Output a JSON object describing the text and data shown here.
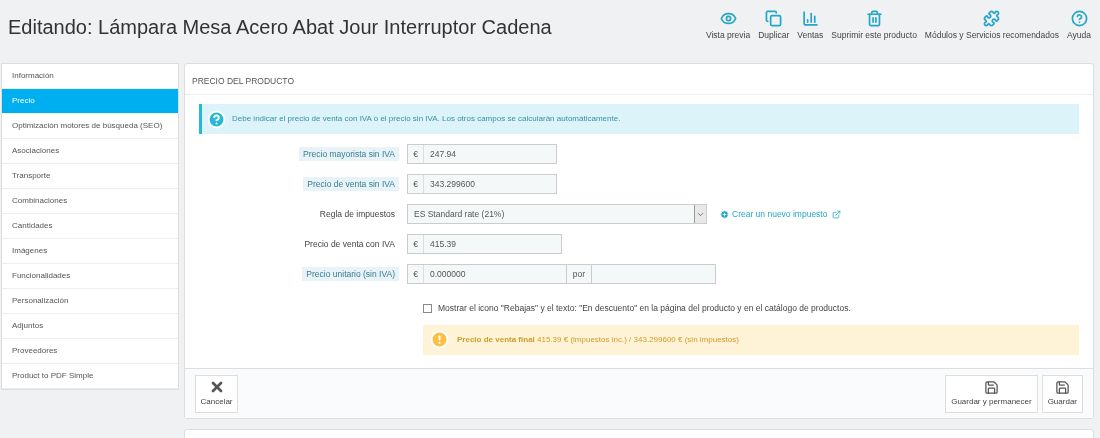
{
  "title": "Editando: Lámpara Mesa Acero Abat Jour Interruptor Cadena",
  "toolbar": [
    {
      "kind": "eye",
      "label": "Vista previa"
    },
    {
      "kind": "copy",
      "label": "Duplicar"
    },
    {
      "kind": "chart",
      "label": "Ventas"
    },
    {
      "kind": "trash",
      "label": "Suprimir este producto"
    },
    {
      "kind": "puzzle",
      "label": "Módulos y Servicios recomendados"
    },
    {
      "kind": "help",
      "label": "Ayuda"
    }
  ],
  "sidebar": {
    "items": [
      {
        "label": "Información",
        "selected": false
      },
      {
        "label": "Precio",
        "selected": true
      },
      {
        "label": "Optimización motores de búsqueda (SEO)",
        "selected": false
      },
      {
        "label": "Asociaciones",
        "selected": false
      },
      {
        "label": "Transporte",
        "selected": false
      },
      {
        "label": "Combinaciones",
        "selected": false
      },
      {
        "label": "Cantidades",
        "selected": false
      },
      {
        "label": "Imágenes",
        "selected": false
      },
      {
        "label": "Funcionalidades",
        "selected": false
      },
      {
        "label": "Personalización",
        "selected": false
      },
      {
        "label": "Adjuntos",
        "selected": false
      },
      {
        "label": "Proveedores",
        "selected": false
      },
      {
        "label": "Product to PDF Simple",
        "selected": false
      }
    ]
  },
  "panel": {
    "heading": "PRECIO DEL PRODUCTO",
    "info": "Debe indicar el precio de venta con IVA o el precio sin IVA. Los otros campos se calcularán automáticamente.",
    "fields": [
      {
        "kind": "money",
        "label": "Precio mayorista sin IVA",
        "has_help": true,
        "currency": "€",
        "value": "247.94"
      },
      {
        "kind": "money",
        "label": "Precio de venta sin IVA",
        "has_help": true,
        "currency": "€",
        "value": "343.299600"
      },
      {
        "kind": "select",
        "label": "Regla de impuestos",
        "has_help": false,
        "value": "ES Standard rate (21%)",
        "link": "Crear un nuevo impuesto"
      },
      {
        "kind": "money",
        "label": "Precio de venta con IVA",
        "has_help": false,
        "currency": "€",
        "value": "415.39"
      },
      {
        "kind": "unit",
        "label": "Precio unitario (sin IVA)",
        "has_help": true,
        "currency": "€",
        "value": "0.000000",
        "per": "por"
      }
    ],
    "checkbox": {
      "label": "Mostrar el icono \"Rebajas\" y el texto: \"En descuento\" en la página del producto y en el catálogo de productos.",
      "checked": false
    },
    "warning": "**Precio de venta final** 415.39 € (impuestos inc.) / 343.299600 € (sin impuestos)",
    "footer": {
      "cancel": "Cancelar",
      "save_stay": "Guardar y permanecer",
      "save": "Guardar"
    }
  }
}
